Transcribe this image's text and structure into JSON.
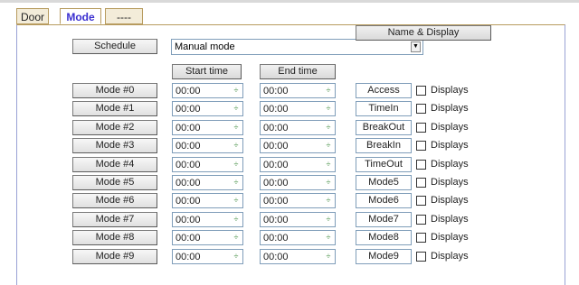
{
  "tabs": [
    "Door",
    "Mode",
    "----"
  ],
  "schedule": {
    "button": "Schedule",
    "selected": "Manual mode"
  },
  "headers": {
    "start": "Start time",
    "end": "End time",
    "name_display": "Name & Display"
  },
  "check_label": "Displays",
  "rows": [
    {
      "label": "Mode #0",
      "start": "00:00",
      "end": "00:00",
      "name": "Access"
    },
    {
      "label": "Mode #1",
      "start": "00:00",
      "end": "00:00",
      "name": "TimeIn"
    },
    {
      "label": "Mode #2",
      "start": "00:00",
      "end": "00:00",
      "name": "BreakOut"
    },
    {
      "label": "Mode #3",
      "start": "00:00",
      "end": "00:00",
      "name": "BreakIn"
    },
    {
      "label": "Mode #4",
      "start": "00:00",
      "end": "00:00",
      "name": "TimeOut"
    },
    {
      "label": "Mode #5",
      "start": "00:00",
      "end": "00:00",
      "name": "Mode5"
    },
    {
      "label": "Mode #6",
      "start": "00:00",
      "end": "00:00",
      "name": "Mode6"
    },
    {
      "label": "Mode #7",
      "start": "00:00",
      "end": "00:00",
      "name": "Mode7"
    },
    {
      "label": "Mode #8",
      "start": "00:00",
      "end": "00:00",
      "name": "Mode8"
    },
    {
      "label": "Mode #9",
      "start": "00:00",
      "end": "00:00",
      "name": "Mode9"
    }
  ]
}
